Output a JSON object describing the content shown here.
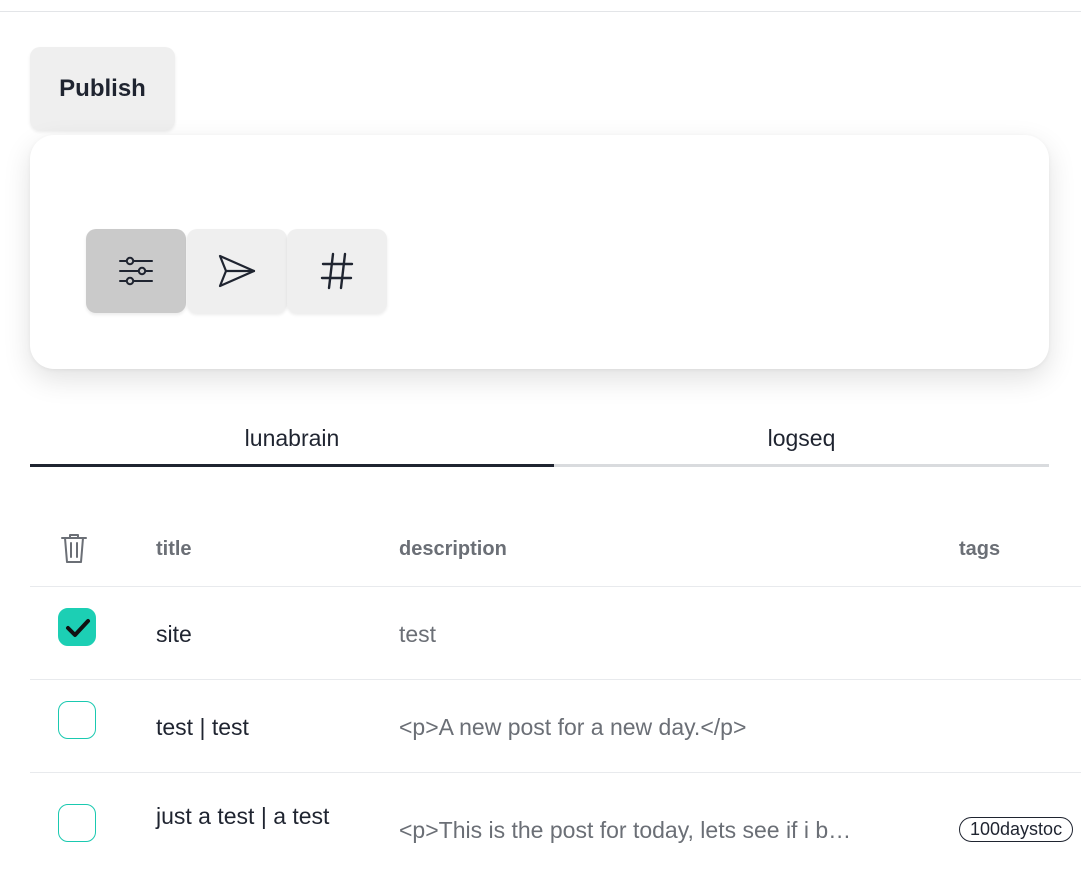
{
  "toolbar": {
    "publish_label": "Publish",
    "tools": [
      {
        "icon": "sliders-icon",
        "active": true
      },
      {
        "icon": "send-icon",
        "active": false
      },
      {
        "icon": "hash-icon",
        "active": false
      }
    ]
  },
  "tabs": [
    {
      "label": "lunabrain",
      "selected": true
    },
    {
      "label": "logseq",
      "selected": false
    }
  ],
  "table": {
    "headers": {
      "delete_icon": "trash-icon",
      "title": "title",
      "description": "description",
      "tags": "tags"
    },
    "rows": [
      {
        "checked": true,
        "title": "site",
        "description": "test",
        "tags": []
      },
      {
        "checked": false,
        "title": "test | test",
        "description": "<p>A new post for a new day.</p>",
        "tags": []
      },
      {
        "checked": false,
        "title": "just a test | a test",
        "description": "<p>This is the post for today, lets see if i b…",
        "tags": [
          "100daystoc"
        ]
      }
    ]
  },
  "colors": {
    "accent": "#1ccfb4",
    "active_tool": "#cacaca",
    "button": "#efefef",
    "text": "#1f2430",
    "muted_text": "#6b6f76"
  }
}
